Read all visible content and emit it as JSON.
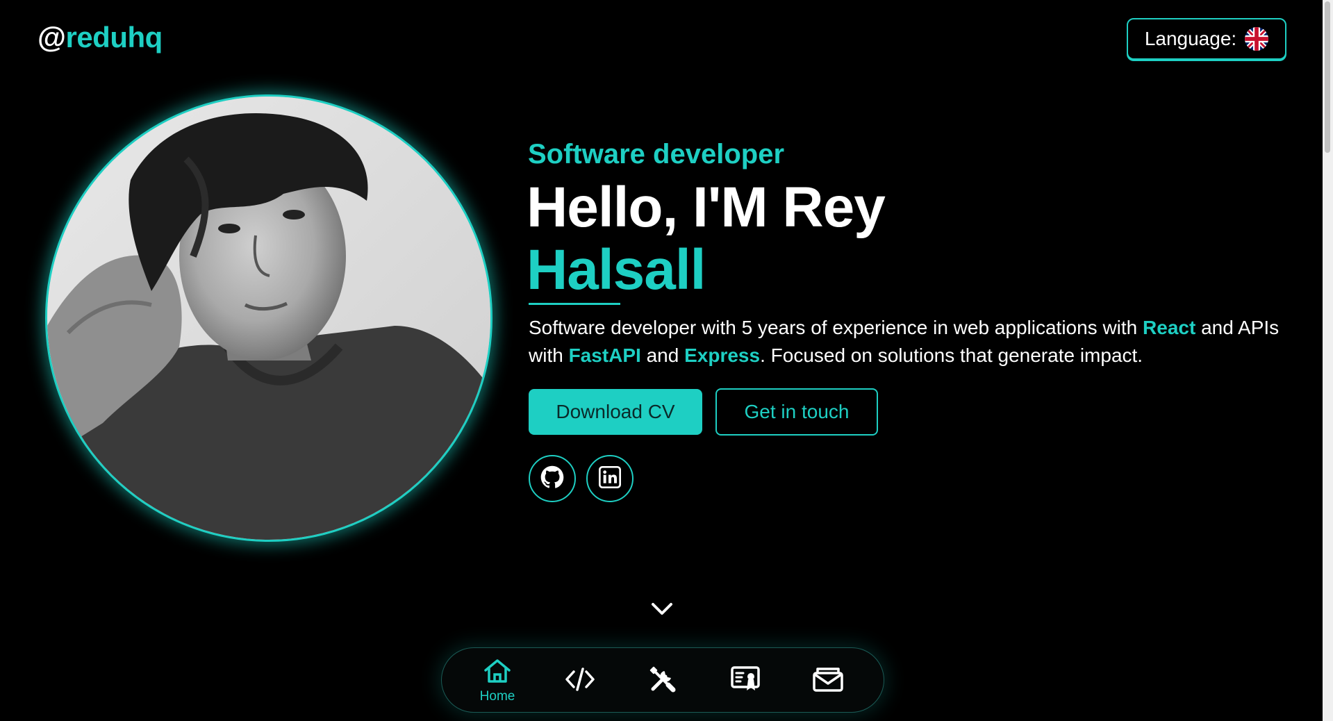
{
  "header": {
    "logo_at": "@",
    "logo_handle": "reduhq",
    "language_label": "Language:",
    "language_flag": "uk-flag-icon"
  },
  "hero": {
    "subtitle": "Software developer",
    "greeting": "Hello, I'M Rey",
    "surname": "Halsall",
    "description": {
      "part1": "Software developer with 5 years of experience in web applications with ",
      "react": "React",
      "part2": " and APIs with ",
      "fastapi": "FastAPI",
      "part3": " and ",
      "express": "Express",
      "part4": ". Focused on solutions that generate impact."
    },
    "download_cv_label": "Download CV",
    "get_in_touch_label": "Get in touch",
    "socials": [
      "github-icon",
      "linkedin-icon"
    ],
    "avatar": "profile-photo"
  },
  "bottom_nav": {
    "items": [
      {
        "icon": "home-icon",
        "label": "Home",
        "active": true
      },
      {
        "icon": "code-icon",
        "label": "",
        "active": false
      },
      {
        "icon": "tools-icon",
        "label": "",
        "active": false
      },
      {
        "icon": "certificate-icon",
        "label": "",
        "active": false
      },
      {
        "icon": "mail-icon",
        "label": "",
        "active": false
      }
    ]
  },
  "colors": {
    "accent": "#1ecfc3",
    "background": "#000000",
    "text": "#ffffff"
  }
}
